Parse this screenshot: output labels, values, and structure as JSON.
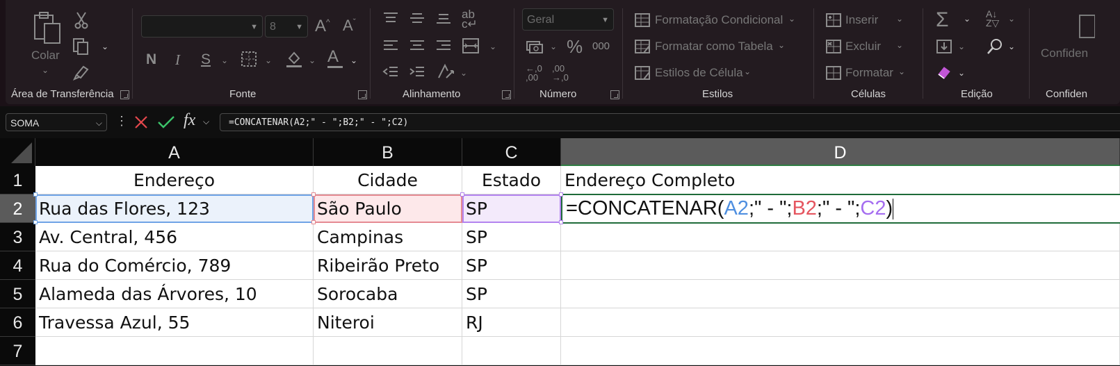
{
  "ribbon": {
    "clipboard": {
      "paste_label": "Colar",
      "group_label": "Área de Transferência"
    },
    "font": {
      "font_name": "",
      "font_size": "8",
      "bold_label": "N",
      "italic_label": "I",
      "underline_label": "S",
      "group_label": "Fonte"
    },
    "alignment": {
      "group_label": "Alinhamento"
    },
    "number": {
      "format_value": "Geral",
      "percent_label": "%",
      "thousands_label": "000",
      "group_label": "Número"
    },
    "styles": {
      "conditional_formatting": "Formatação Condicional",
      "format_as_table": "Formatar como Tabela",
      "cell_styles": "Estilos de Célula",
      "group_label": "Estilos"
    },
    "cells": {
      "insert": "Inserir",
      "delete": "Excluir",
      "format": "Formatar",
      "group_label": "Células"
    },
    "editing": {
      "group_label": "Edição"
    },
    "confidentiality": {
      "button_label": "Confiden",
      "group_label": "Confiden"
    }
  },
  "formula_bar": {
    "name_box": "SOMA",
    "fx_label": "fx",
    "formula": "=CONCATENAR(A2;\" - \";B2;\" - \";C2)"
  },
  "sheet": {
    "columns": [
      "A",
      "B",
      "C",
      "D"
    ],
    "rows": [
      "1",
      "2",
      "3",
      "4",
      "5",
      "6",
      "7"
    ],
    "header_row": [
      "Endereço",
      "Cidade",
      "Estado",
      "Endereço Completo"
    ],
    "data": [
      [
        "Rua das Flores, 123",
        "São Paulo",
        "SP"
      ],
      [
        "Av. Central, 456",
        "Campinas",
        "SP"
      ],
      [
        "Rua do Comércio, 789",
        "Ribeirão Preto",
        "SP"
      ],
      [
        "Alameda das Árvores, 10",
        "Sorocaba",
        "SP"
      ],
      [
        "Travessa Azul, 55",
        "Niteroi",
        "RJ"
      ]
    ],
    "edit_formula": {
      "prefix": "=CONCATENAR(",
      "ref1": "A2",
      "sep1": ";\" - \";",
      "ref2": "B2",
      "sep2": ";\" - \";",
      "ref3": "C2",
      "suffix": ")"
    }
  },
  "colors": {
    "ref_a": "#4f8fe0",
    "ref_b": "#e5555f",
    "ref_c": "#a56ef0",
    "active_cell_border": "#1e6b39"
  }
}
